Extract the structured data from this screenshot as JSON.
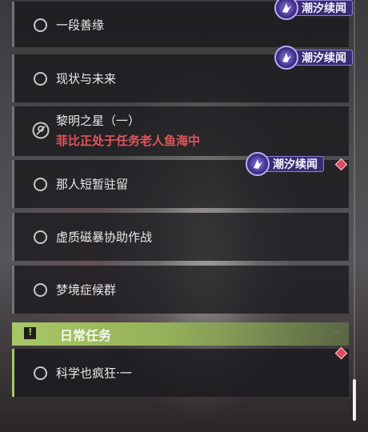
{
  "tasks": [
    {
      "label": "一段善缘"
    },
    {
      "label": "现状与未来"
    },
    {
      "label": "黎明之星（一）",
      "sub": "菲比正处于任务老人鱼海中"
    },
    {
      "label": "那人短暂驻留"
    },
    {
      "label": "虚质磁暴协助作战"
    },
    {
      "label": "梦境症候群"
    }
  ],
  "daily_section": {
    "title": "日常任务",
    "tasks": [
      {
        "label": "科学也疯狂·一"
      }
    ]
  },
  "tag_label": "潮汐续闻",
  "colors": {
    "accent_green": "#a8c766",
    "tag_purple": "#3a2c72",
    "warn_red": "#e0485c",
    "subtitle_red": "#e2565a"
  }
}
